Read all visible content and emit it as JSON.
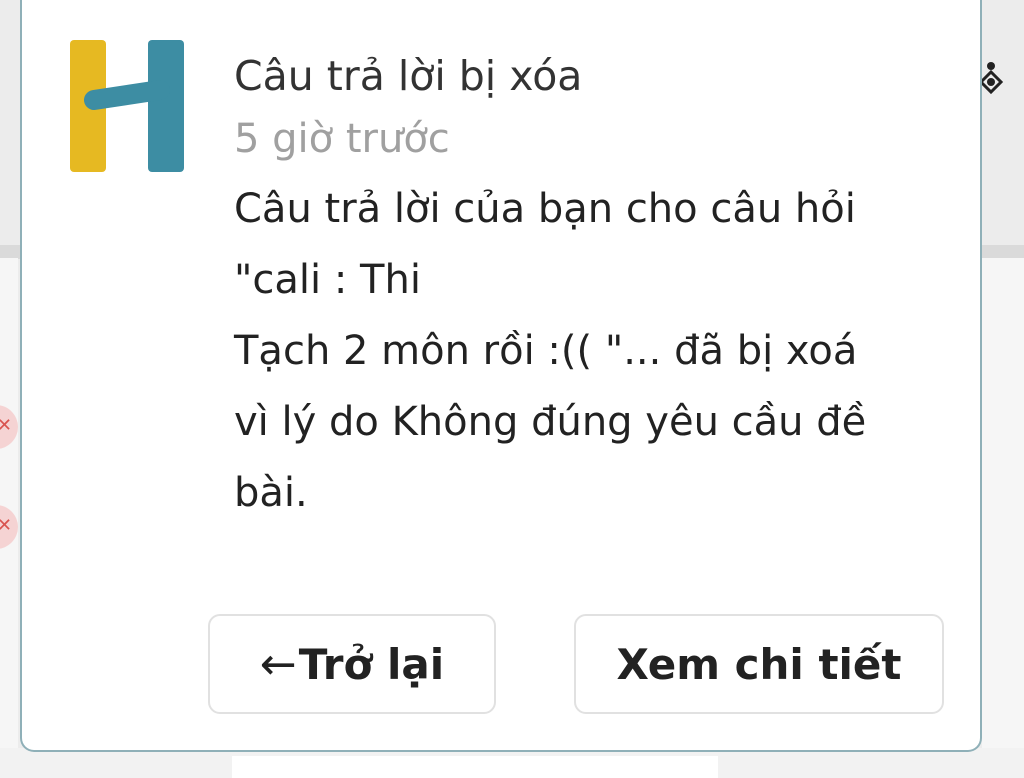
{
  "notification": {
    "title": "Câu trả lời bị xóa",
    "time": "5 giờ trước",
    "message": "Câu trả lời của bạn cho câu hỏi\n\"cali : Thi\nTạch 2 môn rồi :(( \"... đã bị xoá\nvì lý do Không đúng yêu cầu đề\nbài.",
    "logo_colors": {
      "left_bar": "#e6b922",
      "right_bar": "#3d8da3",
      "crossbar": "#3d8da3"
    }
  },
  "buttons": {
    "back_label": "Trở lại",
    "back_icon": "←",
    "detail_label": "Xem chi tiết"
  },
  "colors": {
    "dialog_border": "#8fb0b8",
    "time_text": "#a0a0a0"
  }
}
